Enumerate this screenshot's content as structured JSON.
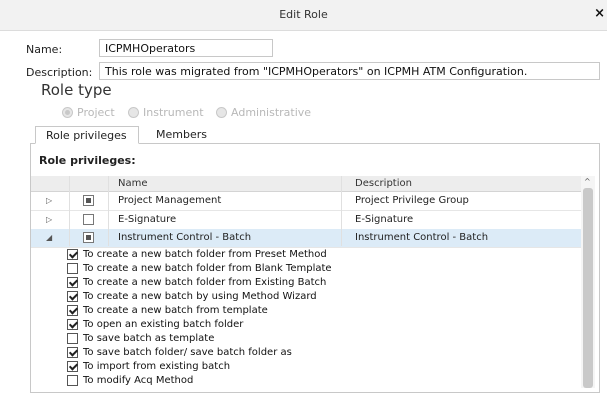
{
  "window": {
    "title": "Edit Role",
    "close_glyph": "×"
  },
  "form": {
    "name_label": "Name:",
    "name_value": "ICPMHOperators",
    "description_label": "Description:",
    "description_value": "This role was migrated from \"ICPMHOperators\" on ICPMH ATM Configuration."
  },
  "role_type": {
    "heading": "Role type",
    "options": [
      {
        "label": "Project",
        "selected": true
      },
      {
        "label": "Instrument",
        "selected": false
      },
      {
        "label": "Administrative",
        "selected": false
      }
    ]
  },
  "tabs": [
    {
      "label": "Role privileges",
      "active": true
    },
    {
      "label": "Members",
      "active": false
    }
  ],
  "privileges_panel": {
    "heading": "Role privileges:",
    "columns": {
      "name": "Name",
      "description": "Description"
    },
    "groups": [
      {
        "expander": "▷",
        "state": "partial",
        "name": "Project Management",
        "description": "Project Privilege Group"
      },
      {
        "expander": "▷",
        "state": "unchecked",
        "name": "E-Signature",
        "description": "E-Signature"
      },
      {
        "expander": "◢",
        "state": "partial",
        "name": "Instrument Control - Batch",
        "description": "Instrument Control - Batch",
        "selected": true
      }
    ],
    "items": [
      {
        "label": "To create a new batch folder from Preset Method",
        "checked": true
      },
      {
        "label": "To create a new batch folder from Blank Template",
        "checked": false
      },
      {
        "label": "To create a new batch folder from Existing Batch",
        "checked": true
      },
      {
        "label": "To create a new batch by using Method Wizard",
        "checked": true
      },
      {
        "label": "To create a new batch from template",
        "checked": true
      },
      {
        "label": "To open an existing batch folder",
        "checked": true
      },
      {
        "label": "To save batch as template",
        "checked": false
      },
      {
        "label": "To save batch folder/ save batch folder as",
        "checked": true
      },
      {
        "label": "To import from existing batch",
        "checked": true
      },
      {
        "label": "To modify Acq Method",
        "checked": false
      }
    ]
  },
  "scrollbar": {
    "up_glyph": "^"
  }
}
